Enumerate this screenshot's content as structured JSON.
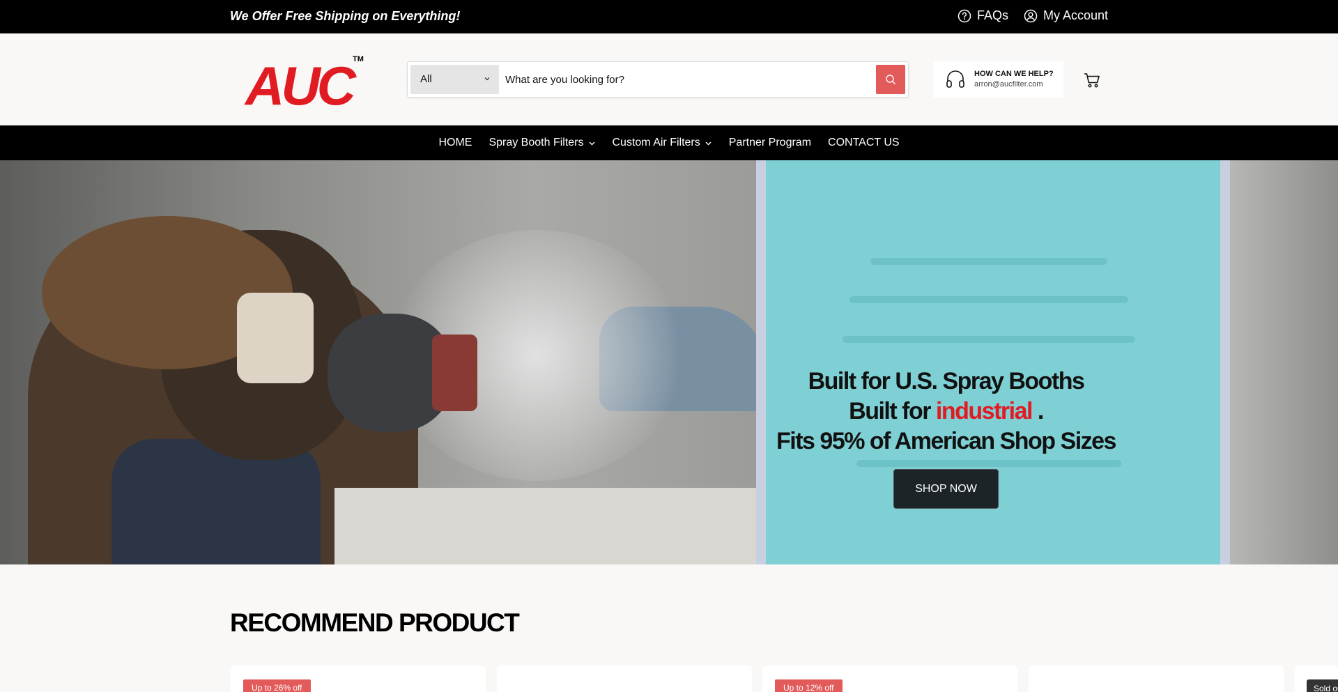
{
  "topbar": {
    "promo": "We Offer Free Shipping on Everything!",
    "faqs_label": "FAQs",
    "account_label": "My Account"
  },
  "header": {
    "logo_text": "AUC",
    "logo_tm": "TM",
    "search": {
      "category_value": "All",
      "placeholder": "What are you looking for?"
    },
    "help": {
      "title": "HOW CAN WE HELP?",
      "email": "arron@aucfilter.com"
    }
  },
  "nav": {
    "items": [
      {
        "label": "HOME"
      },
      {
        "label": "Spray Booth Filters"
      },
      {
        "label": "Custom Air Filters"
      },
      {
        "label": "Partner Program"
      },
      {
        "label": "CONTACT US"
      }
    ]
  },
  "hero": {
    "line1": "Built for U.S. Spray Booths",
    "line2_prefix": "Built for",
    "line2_highlight": "industrial",
    "line2_suffix": ".",
    "line3": "Fits 95% of American Shop Sizes",
    "cta_label": "SHOP NOW"
  },
  "recommend": {
    "title": "RECOMMEND PRODUCT",
    "cards": [
      {
        "badge": "Up to 26% off"
      },
      {
        "badge": ""
      },
      {
        "badge": "Up to 12% off"
      },
      {
        "badge": ""
      }
    ],
    "sold_out_label": "Sold out"
  },
  "colors": {
    "accent_red": "#e11b22",
    "badge_red": "#e25a5a",
    "topbar_bg": "#000000",
    "cta_bg": "#1d2427"
  }
}
